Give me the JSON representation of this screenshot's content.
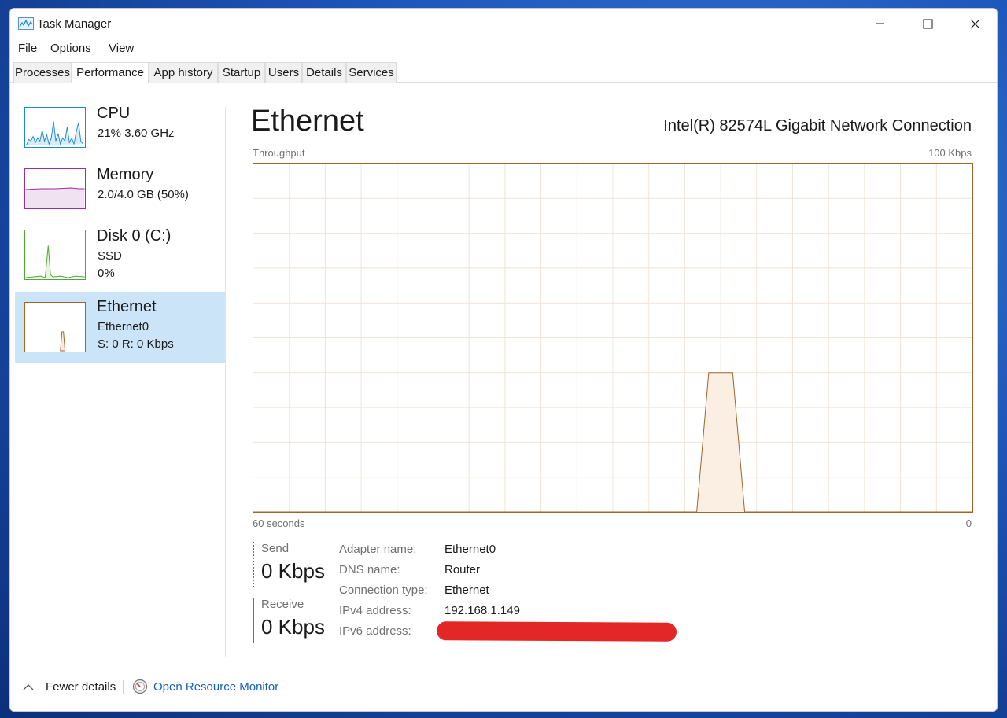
{
  "window": {
    "title": "Task Manager"
  },
  "menu": [
    "File",
    "Options",
    "View"
  ],
  "tabs": [
    "Processes",
    "Performance",
    "App history",
    "Startup",
    "Users",
    "Details",
    "Services"
  ],
  "active_tab": "Performance",
  "sidebar": {
    "items": [
      {
        "title": "CPU",
        "line1": "21%  3.60 GHz",
        "line2": "",
        "color": "#1b8ad0"
      },
      {
        "title": "Memory",
        "line1": "2.0/4.0 GB (50%)",
        "line2": "",
        "color": "#9b2ea0"
      },
      {
        "title": "Disk 0 (C:)",
        "line1": "SSD",
        "line2": "0%",
        "color": "#4da832"
      },
      {
        "title": "Ethernet",
        "line1": "Ethernet0",
        "line2": "S: 0  R: 0 Kbps",
        "color": "#a0642a"
      }
    ],
    "selected": "Ethernet"
  },
  "main": {
    "title": "Ethernet",
    "adapter_name_full": "Intel(R) 82574L Gigabit Network Connection",
    "throughput_label": "Throughput",
    "max_label": "100 Kbps",
    "x_left_label": "60 seconds",
    "x_right_label": "0"
  },
  "chart_data": {
    "type": "area",
    "title": "",
    "ylabel": "Throughput",
    "ylim": [
      0,
      100
    ],
    "x_range_seconds": [
      60,
      0
    ],
    "series": [
      {
        "x": [
          60,
          23,
          22,
          21,
          20,
          19,
          0
        ],
        "values": [
          0,
          0,
          40,
          40,
          40,
          0,
          0
        ]
      }
    ]
  },
  "stats": {
    "send_label": "Send",
    "send_value": "0 Kbps",
    "receive_label": "Receive",
    "receive_value": "0 Kbps"
  },
  "info": [
    {
      "label": "Adapter name:",
      "value": "Ethernet0"
    },
    {
      "label": "DNS name:",
      "value": "Router"
    },
    {
      "label": "Connection type:",
      "value": "Ethernet"
    },
    {
      "label": "IPv4 address:",
      "value": "192.168.1.149"
    },
    {
      "label": "IPv6 address:",
      "value": ""
    }
  ],
  "footer": {
    "fewer_details": "Fewer details",
    "open_resource_monitor": "Open Resource Monitor"
  },
  "icons": {
    "app": "task-manager-icon",
    "minimize": "minimize-icon",
    "maximize": "maximize-icon",
    "close": "close-icon",
    "chevron": "chevron-up-icon",
    "resource_monitor": "resource-monitor-icon"
  }
}
